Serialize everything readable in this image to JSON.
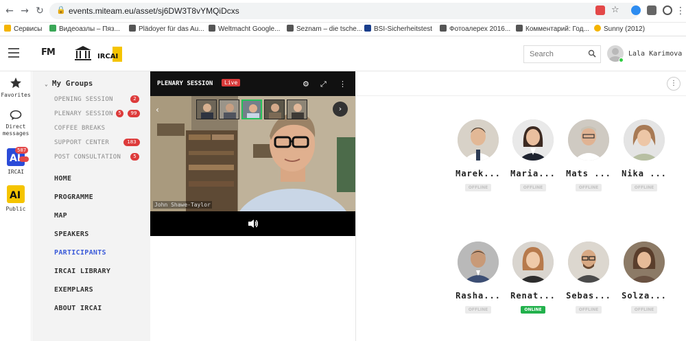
{
  "browser": {
    "url": "events.miteam.eu/asset/sj6DW3T8vYMQiDcxs",
    "bookmarks": [
      "Сервисы",
      "Видеоазлы – Пяз...",
      "Plädoyer für das Au...",
      "Weltmacht Google...",
      "Seznam – die tsche...",
      "BSI-Sicherheitstest",
      "Фотоалерех 2016...",
      "Комментарий: Год...",
      "Sunny (2012)"
    ]
  },
  "header": {
    "logo_text": "FM",
    "ircai_text": "IRCAI",
    "search_placeholder": "Search",
    "user_name": "Lala Karimova"
  },
  "rail": {
    "favorites": "Favorites",
    "direct_messages": "Direct messages",
    "ircai": "IRCAI",
    "ircai_badge": "587",
    "public": "Public"
  },
  "groups": {
    "title": "My Groups",
    "items": [
      {
        "label": "OPENING SESSION",
        "badge": "2"
      },
      {
        "label": "PLENARY SESSION",
        "badge": "5",
        "badge2": "99"
      },
      {
        "label": "COFFEE BREAKS",
        "badge": ""
      },
      {
        "label": "SUPPORT CENTER",
        "badge": "183"
      },
      {
        "label": "POST CONSULTATION",
        "badge": "5"
      }
    ]
  },
  "menu": [
    "HOME",
    "PROGRAMME",
    "MAP",
    "SPEAKERS",
    "PARTICIPANTS",
    "IRCAI LIBRARY",
    "EXEMPLARS",
    "ABOUT IRCAI"
  ],
  "video": {
    "session_title": "PLENARY SESSION",
    "live_label": "Live",
    "speaker_name": "John Shawe-Taylor"
  },
  "participants": [
    {
      "name": "Marek...",
      "status": "OFFLINE"
    },
    {
      "name": "Maria...",
      "status": "OFFLINE"
    },
    {
      "name": "Mats ...",
      "status": "OFFLINE"
    },
    {
      "name": "Nika ...",
      "status": "OFFLINE"
    },
    {
      "name": "Rasha...",
      "status": "OFFLINE"
    },
    {
      "name": "Renat...",
      "status": "ONLINE"
    },
    {
      "name": "Sebas...",
      "status": "OFFLINE"
    },
    {
      "name": "Solza...",
      "status": "OFFLINE"
    }
  ],
  "colors": {
    "accent": "#3b5bd9",
    "live": "#d93a3a",
    "online": "#22b14c",
    "badge": "#dd3b3b",
    "ircai_yellow": "#f5c400"
  }
}
